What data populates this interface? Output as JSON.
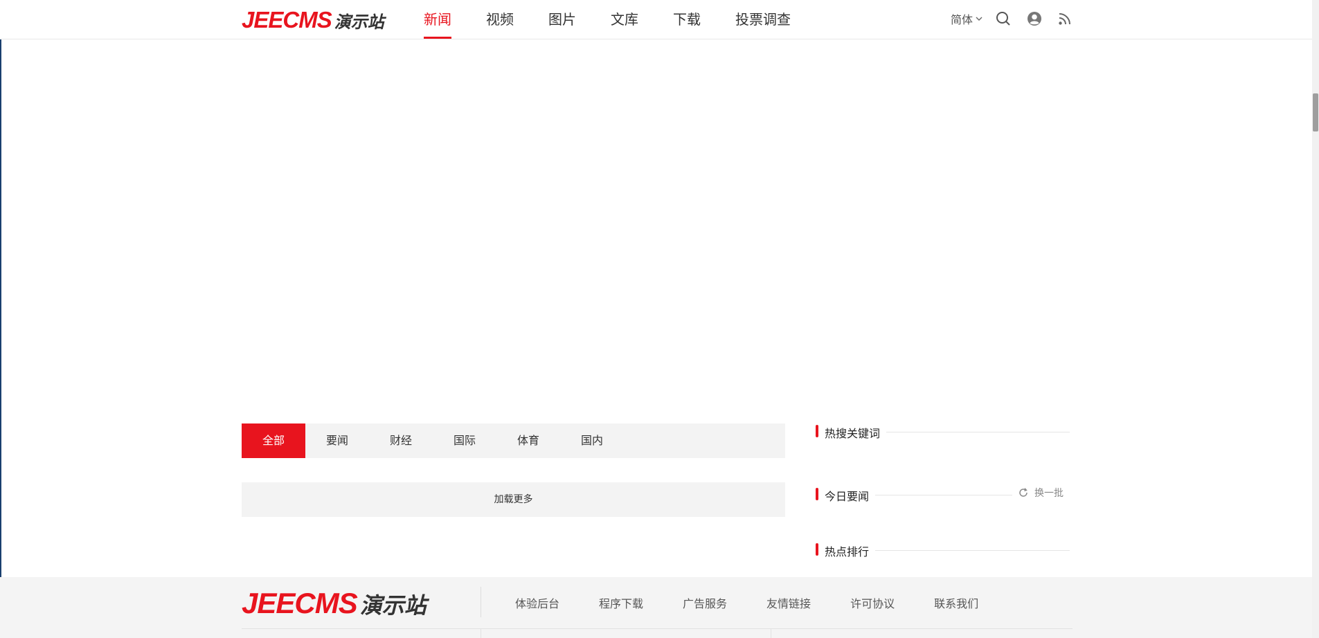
{
  "header": {
    "logo": {
      "en": "JEECMS",
      "cn": "演示站"
    },
    "nav": [
      {
        "label": "新闻",
        "active": true
      },
      {
        "label": "视频",
        "active": false
      },
      {
        "label": "图片",
        "active": false
      },
      {
        "label": "文库",
        "active": false
      },
      {
        "label": "下载",
        "active": false
      },
      {
        "label": "投票调查",
        "active": false
      }
    ],
    "language": "简体",
    "icons": [
      "search-icon",
      "user-icon",
      "rss-icon"
    ]
  },
  "tabs": [
    {
      "label": "全部",
      "active": true
    },
    {
      "label": "要闻",
      "active": false
    },
    {
      "label": "财经",
      "active": false
    },
    {
      "label": "国际",
      "active": false
    },
    {
      "label": "体育",
      "active": false
    },
    {
      "label": "国内",
      "active": false
    }
  ],
  "load_more": "加载更多",
  "sidebar": {
    "hot_keywords": "热搜关键词",
    "today_news": "今日要闻",
    "refresh": "换一批",
    "hot_ranking": "热点排行"
  },
  "footer": {
    "logo": {
      "en": "JEECMS",
      "cn": "演示站"
    },
    "links": [
      "体验后台",
      "程序下载",
      "广告服务",
      "友情链接",
      "许可协议",
      "联系我们"
    ]
  },
  "colors": {
    "accent": "#e8141e",
    "panel_bg": "#f3f3f3",
    "footer_bg": "#f4f4f4",
    "text": "#333333"
  }
}
